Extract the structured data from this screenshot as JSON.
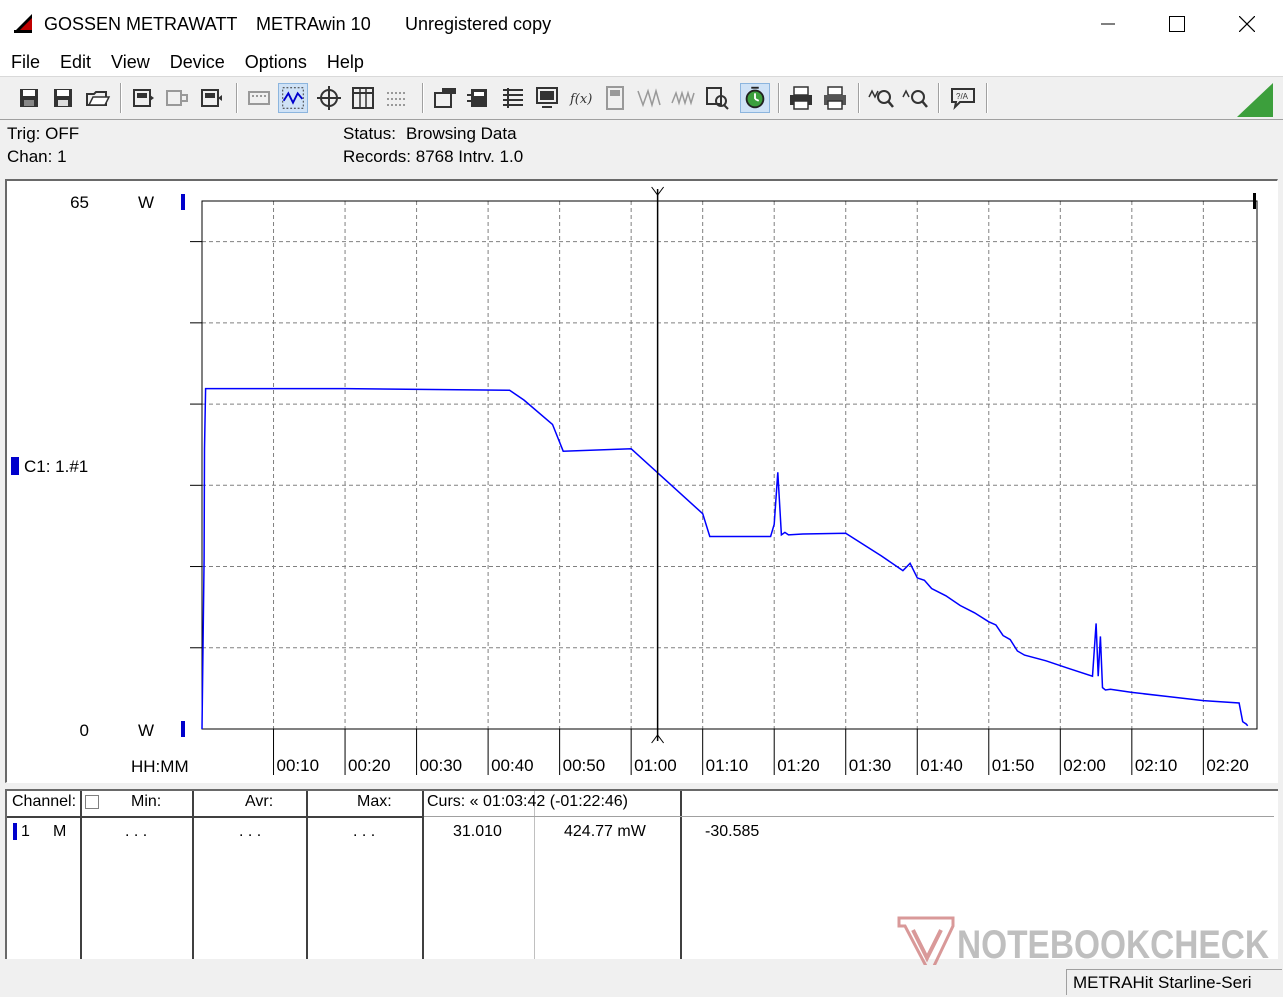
{
  "titlebar": {
    "vendor": "GOSSEN METRAWATT",
    "app": "METRAwin 10",
    "license": "Unregistered copy"
  },
  "menu": [
    "File",
    "Edit",
    "View",
    "Device",
    "Options",
    "Help"
  ],
  "info": {
    "trig": "Trig: OFF",
    "chan": "Chan:  1",
    "status_label": "Status:",
    "status_value": "Browsing Data",
    "records": "Records: 8768   Intrv. 1.0"
  },
  "chart_data": {
    "type": "line",
    "y_top_label": "65",
    "y_bottom_label": "0",
    "y_unit": "W",
    "channel_label": "C1: 1.#1",
    "x_axis_label": "HH:MM",
    "ylim": [
      0,
      65
    ],
    "xlim_minutes": [
      0,
      147.5
    ],
    "ticks": [
      "00:10",
      "00:20",
      "00:30",
      "00:40",
      "00:50",
      "01:00",
      "01:10",
      "01:20",
      "01:30",
      "01:40",
      "01:50",
      "02:00",
      "02:10",
      "02:20"
    ],
    "cursor_minute": 63.7,
    "grid": true,
    "series": [
      {
        "color": "#0000ff",
        "x": [
          0,
          0.3,
          0.35,
          0.5,
          20,
          43,
          45,
          49,
          50.5,
          60,
          65,
          70,
          71,
          79.5,
          80,
          80.5,
          81,
          81.5,
          82,
          84,
          90,
          95,
          98,
          99,
          100,
          101,
          102,
          104,
          106,
          108,
          110,
          111,
          112,
          113,
          114,
          115,
          118,
          121,
          124.5,
          125,
          125.3,
          125.6,
          125.9,
          126.3,
          127,
          130,
          135,
          140,
          145,
          145.5,
          146,
          146.2
        ],
        "y": [
          0,
          21,
          34.5,
          41.9,
          41.9,
          41.7,
          40.5,
          37.5,
          34.2,
          34.5,
          30.5,
          26.5,
          23.7,
          23.7,
          25.2,
          31.6,
          23.9,
          24.2,
          23.9,
          24.0,
          24.1,
          21.3,
          19.5,
          20.4,
          18.6,
          18.3,
          17.3,
          16.4,
          15.2,
          14.3,
          13.2,
          12.8,
          11.5,
          11.0,
          9.6,
          9.1,
          8.4,
          7.5,
          6.5,
          13.0,
          6.5,
          11.4,
          5.1,
          4.8,
          4.9,
          4.5,
          4.0,
          3.5,
          3.2,
          0.9,
          0.6,
          0.4
        ]
      }
    ]
  },
  "table": {
    "headers": {
      "channel": "Channel:",
      "min": "Min:",
      "avr": "Avr:",
      "max": "Max:",
      "curs": "Curs: « 01:03:42 (-01:22:46)"
    },
    "row": {
      "channel": "1",
      "mode": "M",
      "min": ". . .",
      "avr": ". . .",
      "max": ". . .",
      "curs_value": "31.010",
      "delta": "424.77  mW",
      "diff": "-30.585"
    }
  },
  "statusbar": {
    "device": "METRAHit Starline-Seri"
  },
  "watermark": {
    "text": "NOTEBOOKCHECK"
  },
  "colors": {
    "series": "#0000ff",
    "grid": "#808080",
    "accent_green": "#3c9f3c",
    "watermark_red": "#c9302c"
  }
}
